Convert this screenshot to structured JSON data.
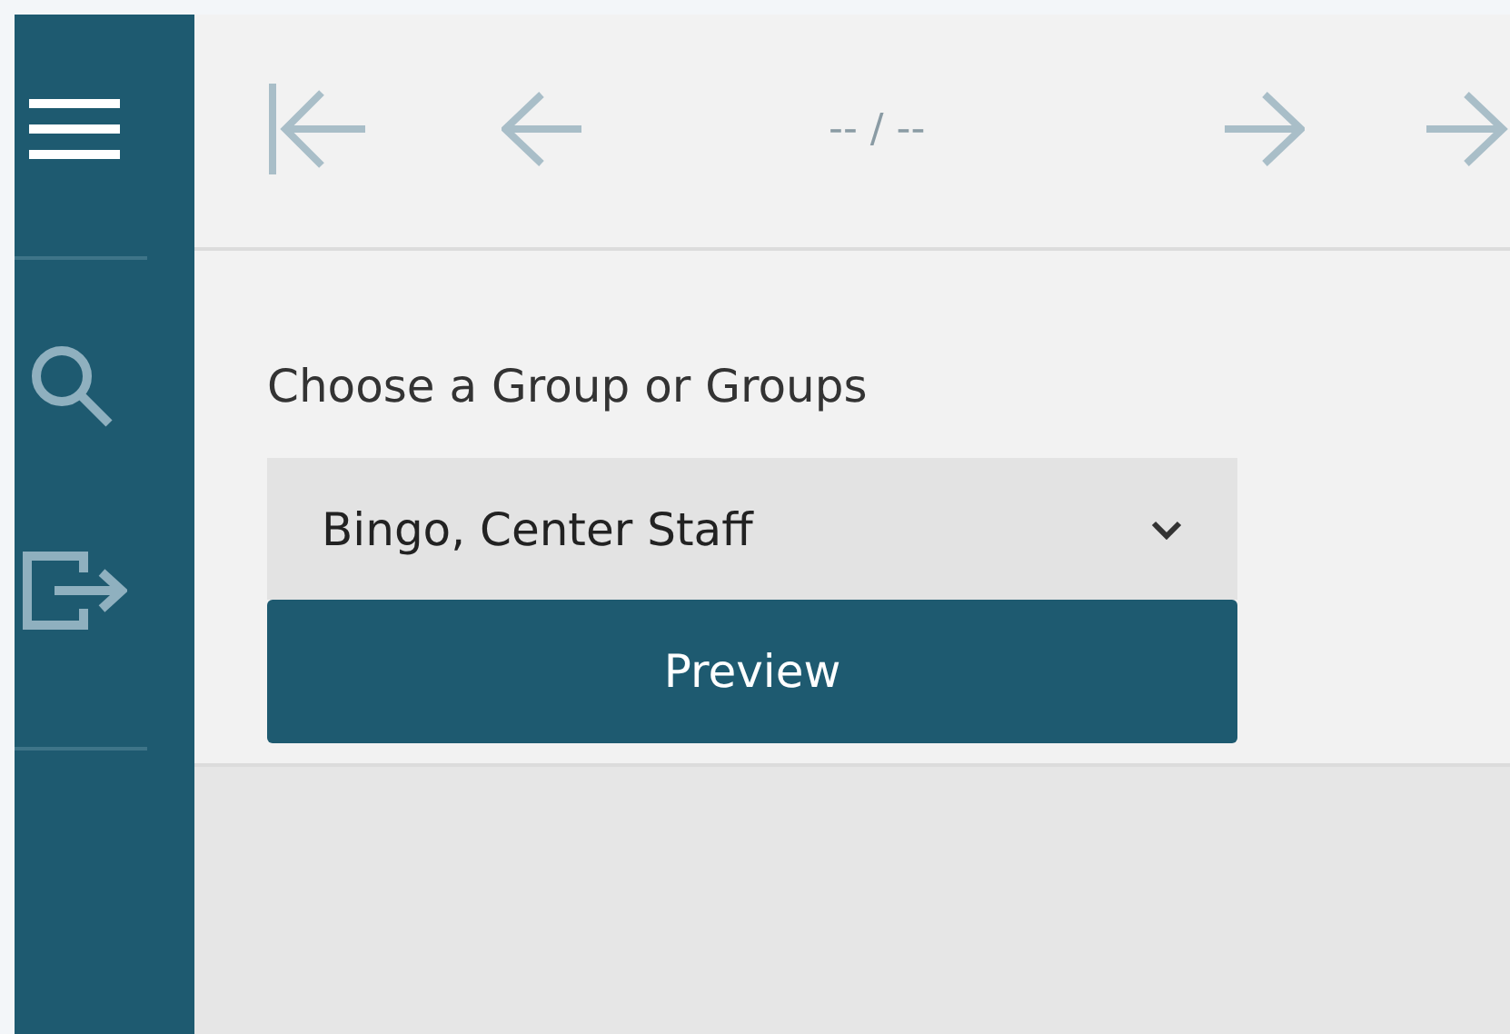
{
  "toolbar": {
    "page_indicator": "-- / --"
  },
  "form": {
    "label": "Choose a Group or Groups",
    "select": {
      "value": "Bingo, Center Staff"
    },
    "button": "Preview"
  }
}
